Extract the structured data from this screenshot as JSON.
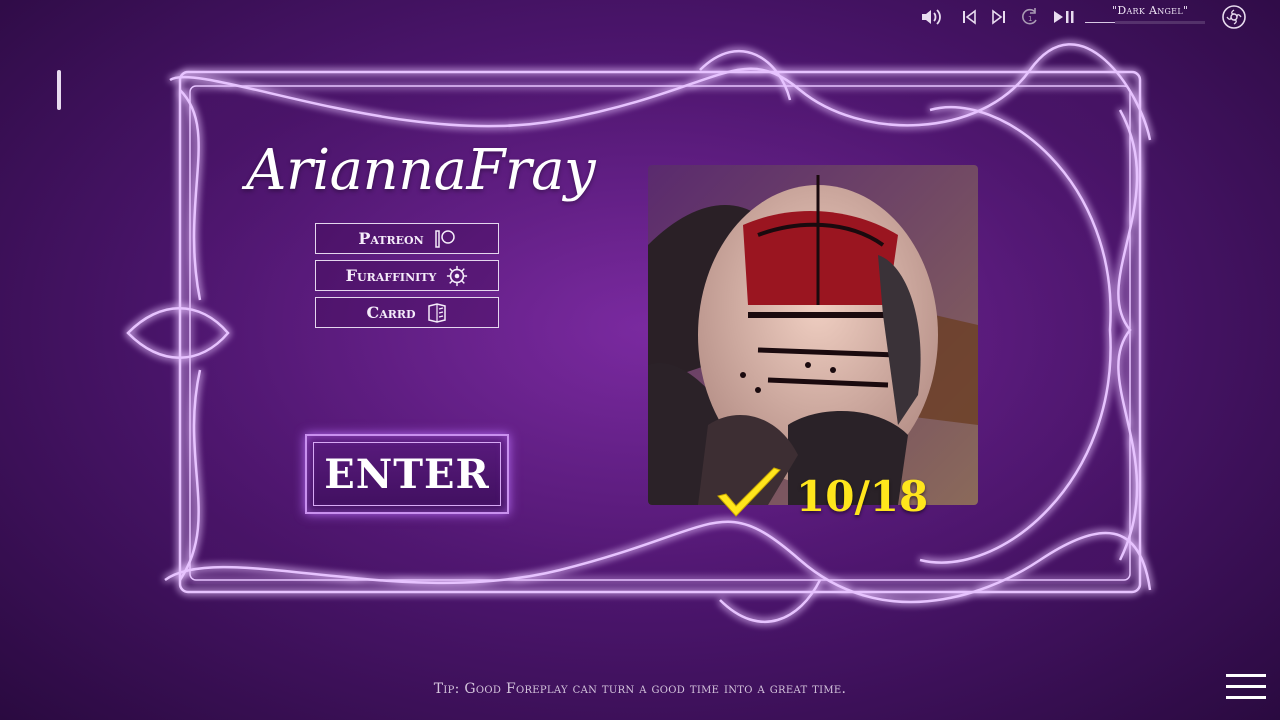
{
  "top_bar": {
    "track_name": "\"Dark Angel\"",
    "icons": [
      "volume-icon",
      "previous-track-icon",
      "next-track-icon",
      "replay-icon",
      "play-pause-icon",
      "gallery-icon"
    ]
  },
  "artist": {
    "name": "AriannaFray"
  },
  "links": [
    {
      "label": "Patreon",
      "icon": "patreon-icon"
    },
    {
      "label": "Furaffinity",
      "icon": "furaffinity-icon"
    },
    {
      "label": "Carrd",
      "icon": "carrd-icon"
    }
  ],
  "enter_label": "ENTER",
  "progress": {
    "text": "10/18",
    "unlocked": 10,
    "total": 18
  },
  "tip": "Tip: Good Foreplay can turn a good time into a great time.",
  "colors": {
    "neon": "#c77dff",
    "accent_yellow": "#ffe61c",
    "background": "#4e1670"
  }
}
